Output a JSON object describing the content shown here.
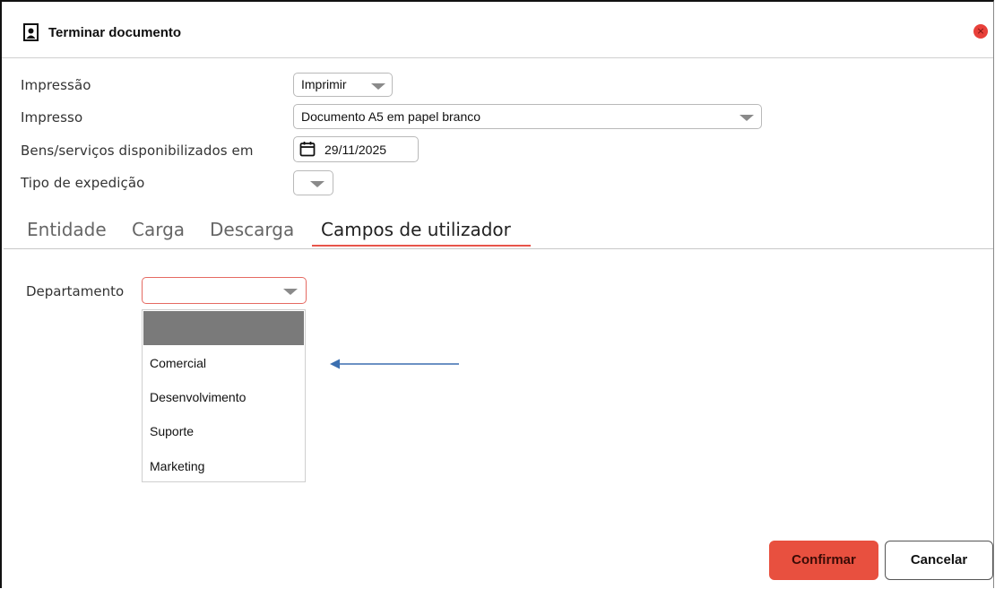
{
  "dialog": {
    "title": "Terminar documento",
    "title_icon": "document-icon",
    "close_icon": "close-icon",
    "close_glyph": "×"
  },
  "form": {
    "impressao": {
      "label": "Impressão",
      "value": "Imprimir"
    },
    "impresso": {
      "label": "Impresso",
      "value": "Documento A5 em papel branco"
    },
    "bens_servicos": {
      "label": "Bens/serviços disponibilizados em",
      "value": "29/11/2025",
      "icon": "calendar-icon"
    },
    "tipo_expedicao": {
      "label": "Tipo de expedição",
      "value": ""
    }
  },
  "tabs": [
    {
      "label": "Entidade",
      "active": false
    },
    {
      "label": "Carga",
      "active": false
    },
    {
      "label": "Descarga",
      "active": false
    },
    {
      "label": "Campos de utilizador",
      "active": true
    }
  ],
  "departamento": {
    "label": "Departamento",
    "value": "",
    "options": [
      "",
      "Comercial",
      "Desenvolvimento",
      "Suporte",
      "Marketing"
    ],
    "highlighted_index": 0
  },
  "buttons": {
    "confirm": "Confirmar",
    "cancel": "Cancelar"
  },
  "colors": {
    "accent": "#e8503f",
    "close": "#e8403a",
    "arrow": "#3b6fb0",
    "highlight": "#7a7a7a"
  }
}
